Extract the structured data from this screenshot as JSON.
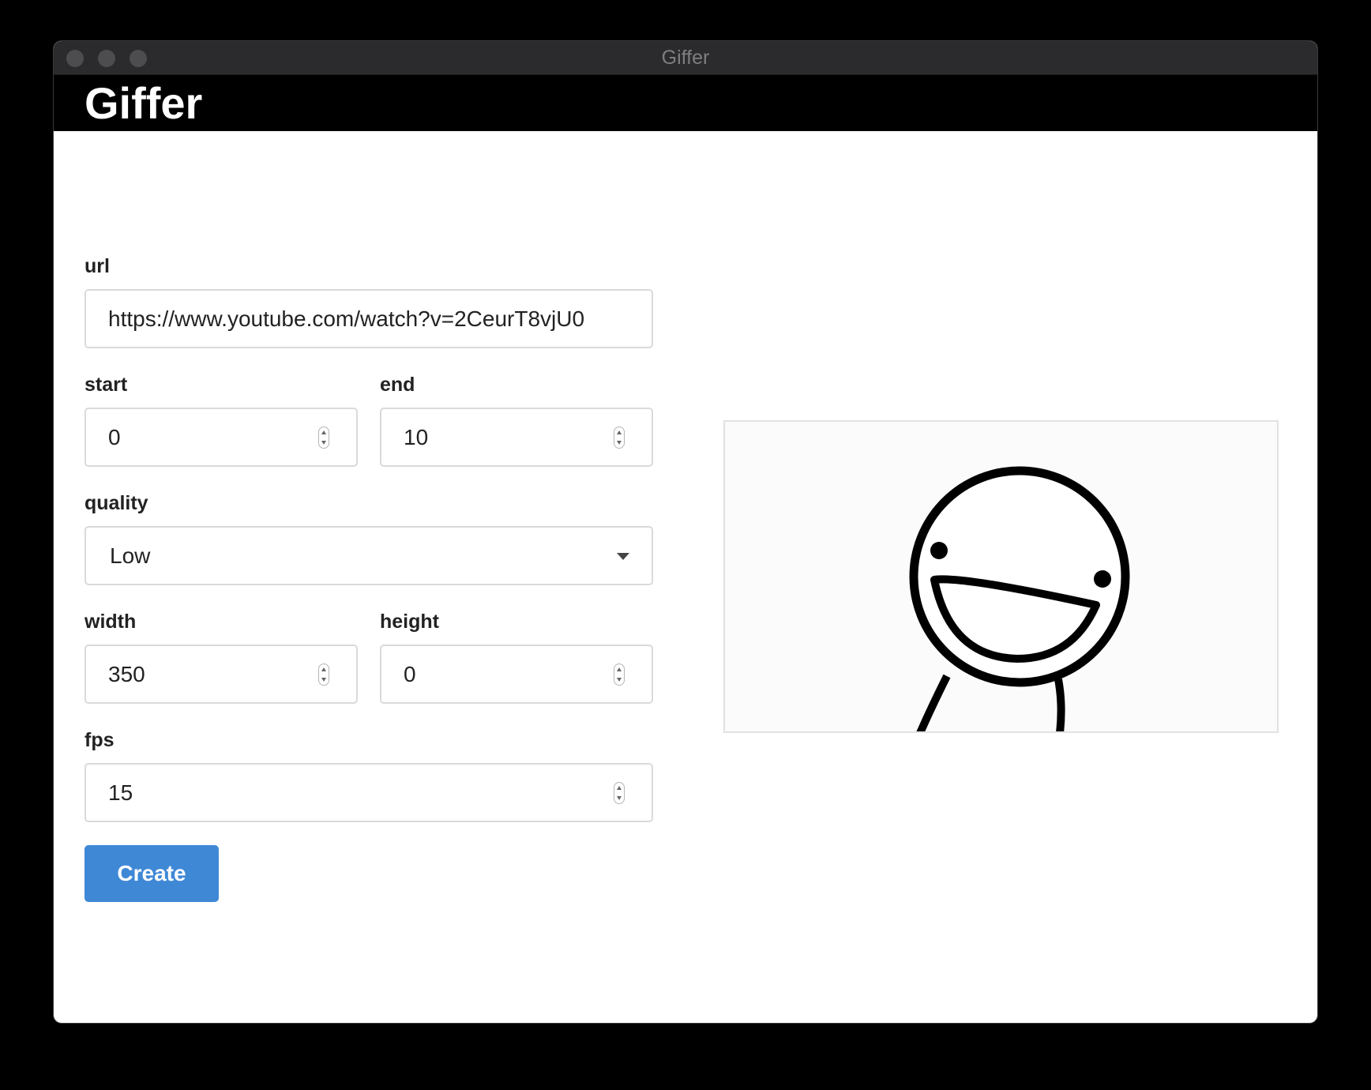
{
  "window": {
    "title": "Giffer"
  },
  "header": {
    "title": "Giffer"
  },
  "form": {
    "url": {
      "label": "url",
      "value": "https://www.youtube.com/watch?v=2CeurT8vjU0"
    },
    "start": {
      "label": "start",
      "value": "0"
    },
    "end": {
      "label": "end",
      "value": "10"
    },
    "quality": {
      "label": "quality",
      "selected": "Low"
    },
    "width": {
      "label": "width",
      "value": "350"
    },
    "height": {
      "label": "height",
      "value": "0"
    },
    "fps": {
      "label": "fps",
      "value": "15"
    },
    "create_label": "Create"
  },
  "icons": {
    "spinner": "number-stepper-icon",
    "dropdown": "caret-down-icon"
  },
  "colors": {
    "primary_button": "#3f88d6",
    "header_bg": "#000000",
    "titlebar_bg": "#2b2b2d"
  }
}
